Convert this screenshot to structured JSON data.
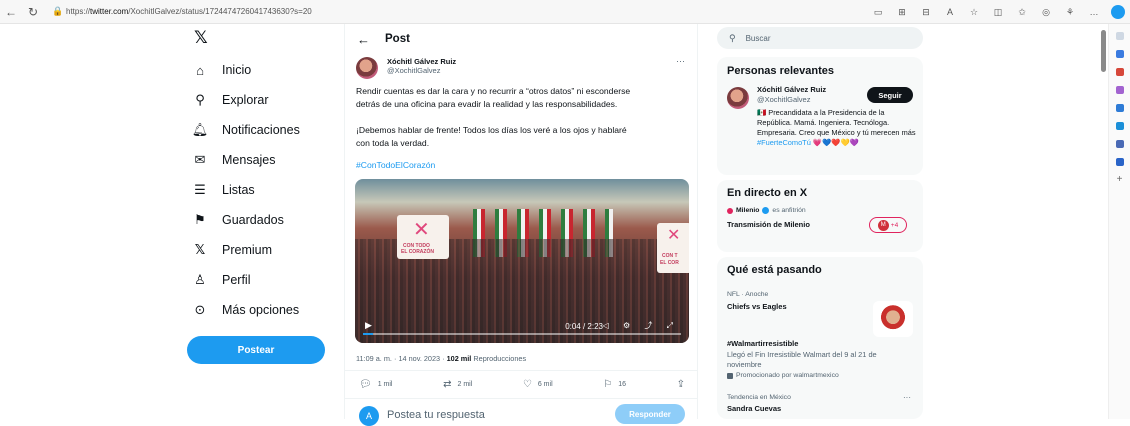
{
  "browser": {
    "url_prefix": "https://",
    "url_host": "twitter.com",
    "url_path": "/XochitlGalvez/status/1724474726041743630?s=20"
  },
  "colors": {
    "accent": "#1d9bf0",
    "text": "#0f1419",
    "muted": "#536471",
    "live": "#e0245e"
  },
  "nav": {
    "logo": "𝕏",
    "items": [
      {
        "icon": "home-icon",
        "label": "Inicio"
      },
      {
        "icon": "search-icon",
        "label": "Explorar"
      },
      {
        "icon": "bell-icon",
        "label": "Notificaciones"
      },
      {
        "icon": "envelope-icon",
        "label": "Mensajes"
      },
      {
        "icon": "list-icon",
        "label": "Listas"
      },
      {
        "icon": "bookmark-icon",
        "label": "Guardados"
      },
      {
        "icon": "x-premium-icon",
        "label": "Premium"
      },
      {
        "icon": "person-icon",
        "label": "Perfil"
      },
      {
        "icon": "more-circle-icon",
        "label": "Más opciones"
      }
    ],
    "post_button": "Postear"
  },
  "post": {
    "header": "Post",
    "author_name": "Xóchitl Gálvez Ruiz",
    "author_handle": "@XochitlGalvez",
    "text_line1": "Rendir cuentas es dar la cara y no recurrir a “otros datos” ni esconderse",
    "text_line2": "detrás de una oficina para evadir la realidad y las responsabilidades.",
    "text_line3": "¡Debemos hablar de frente! Todos los días los veré a los ojos y hablaré",
    "text_line4": "con toda la verdad.",
    "hashtag": "#ConTodoElCorazón",
    "video": {
      "time": "0:04 / 2:23",
      "progress": 0.03,
      "sign_left_line1": "CON TODO",
      "sign_left_line2": "EL CORAZÓN",
      "sign_right_line1": "CON T",
      "sign_right_line2": "EL COR"
    },
    "meta_time": "11:09 a. m. · 14 nov. 2023 · ",
    "meta_views": "102 mil",
    "meta_views_label": " Reproducciones",
    "actions": {
      "replies": "1 mil",
      "reposts": "2 mil",
      "likes": "6 mil",
      "bookmarks": "16"
    },
    "reply_avatar_letter": "A",
    "reply_placeholder": "Postea tu respuesta",
    "reply_button": "Responder"
  },
  "sidebar": {
    "search_placeholder": "Buscar",
    "relevant": {
      "title": "Personas relevantes",
      "name": "Xóchitl Gálvez Ruiz",
      "handle": "@XochitlGalvez",
      "follow": "Seguir",
      "bio_flag": "🇲🇽",
      "bio": "Precandidata a la Presidencia de la República. Mamá. Ingeniera. Tecnóloga. Empresaria. Creo que México y tú merecen más",
      "bio_tag": "#FuerteComoTú",
      "bio_hearts": "💗💙❤️💛💜"
    },
    "live": {
      "title": "En directo en X",
      "host": "Milenio",
      "host_suffix": "es anfitrión",
      "stream": "Transmisión de Milenio",
      "badge_letter": "M",
      "badge_count": "+4"
    },
    "trends": {
      "title": "Qué está pasando",
      "items": [
        {
          "meta": "NFL · Anoche",
          "title": "Chiefs vs Eagles"
        },
        {
          "title": "#Walmartirresistible",
          "desc": "Llegó el Fin Irresistible Walmart del 9 al 21 de noviembre",
          "promo": "Promocionado por walmartmexico"
        },
        {
          "meta": "Tendencia en México",
          "title": "Sandra Cuevas"
        }
      ]
    }
  }
}
